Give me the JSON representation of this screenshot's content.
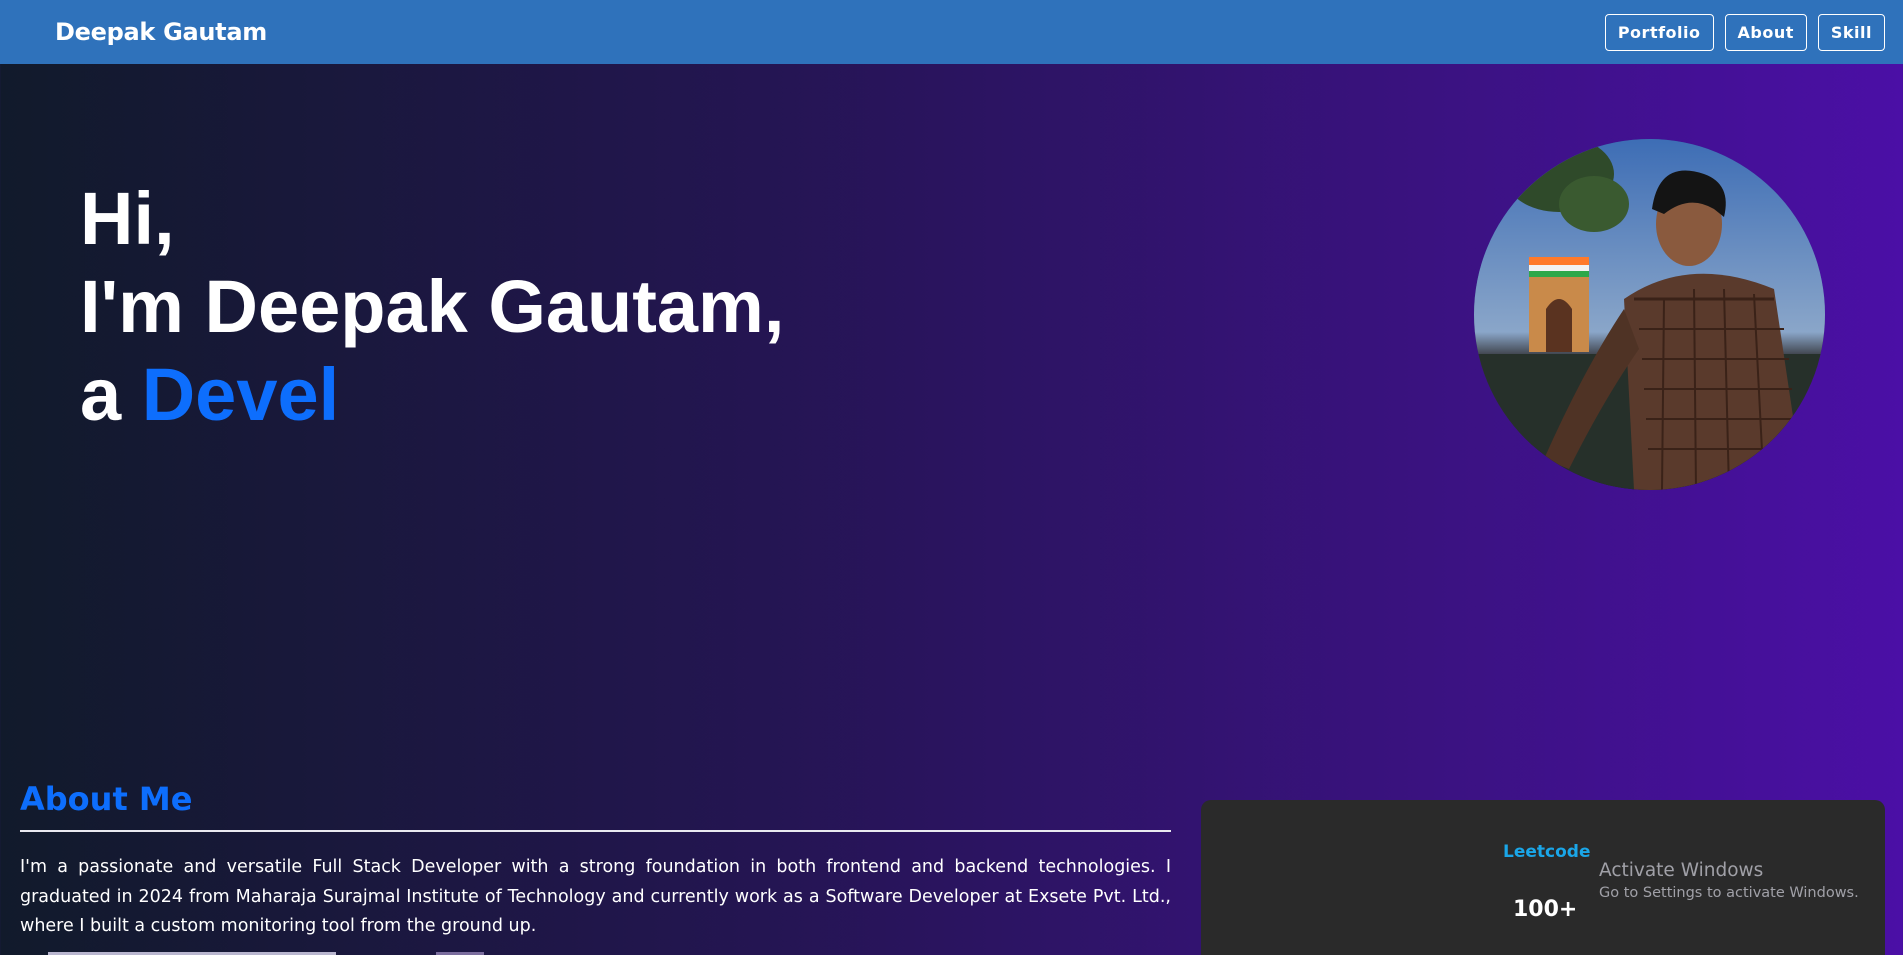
{
  "navbar": {
    "brand": "Deepak Gautam",
    "buttons": [
      "Portfolio",
      "About",
      "Skill"
    ]
  },
  "hero": {
    "line1": "Hi,",
    "line2": "I'm Deepak Gautam,",
    "line3_prefix": "a",
    "line3_role": "Devel",
    "role_color": "#0d6efd"
  },
  "about": {
    "title": "About Me",
    "text": "I'm a passionate and versatile Full Stack Developer with a strong foundation in both frontend and backend technologies. I graduated in 2024 from Maharaja Surajmal Institute of Technology and currently work as a Software Developer at Exsete Pvt. Ltd., where I built a custom monitoring tool from the ground up."
  },
  "stats": {
    "label": "Leetcode",
    "value": "100+"
  },
  "watermark": {
    "title": "Activate Windows",
    "subtitle": "Go to Settings to activate Windows."
  },
  "colors": {
    "navbar": "#2f72bb",
    "accent": "#0d6efd",
    "stat_label": "#1aa6e8",
    "card": "#2a2a2a"
  }
}
